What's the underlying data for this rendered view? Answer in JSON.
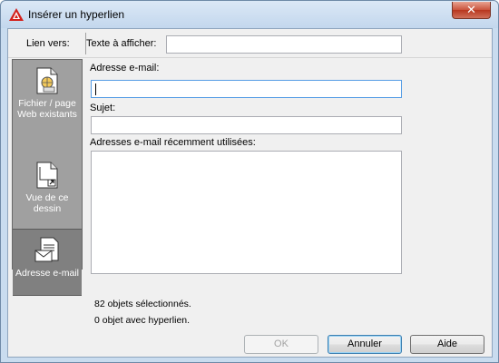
{
  "window": {
    "title": "Insérer un hyperlien",
    "close_glyph": "✕",
    "app_icon": "autocad-a-icon"
  },
  "link_to": {
    "label": "Lien vers:",
    "display_text_label": "Texte à afficher:",
    "display_text_value": ""
  },
  "sidebar": {
    "items": [
      {
        "label_line1": "Fichier / page",
        "label_line2": "Web existants",
        "icon": "web-file-icon",
        "selected": false
      },
      {
        "label_line1": "Vue de ce",
        "label_line2": "dessin",
        "icon": "drawing-view-icon",
        "selected": false
      },
      {
        "label_line1": "Adresse e-mail",
        "label_line2": "",
        "icon": "email-address-icon",
        "selected": true
      }
    ]
  },
  "email_form": {
    "email_label": "Adresse e-mail:",
    "email_value": "",
    "subject_label": "Sujet:",
    "subject_value": "",
    "recent_label": "Adresses e-mail récemment utilisées:",
    "recent_items": []
  },
  "status": {
    "selected_objects": "82 objets sélectionnés.",
    "hyperlinked_objects": "0 objet avec hyperlien."
  },
  "buttons": {
    "ok": "OK",
    "cancel": "Annuler",
    "help": "Aide"
  }
}
